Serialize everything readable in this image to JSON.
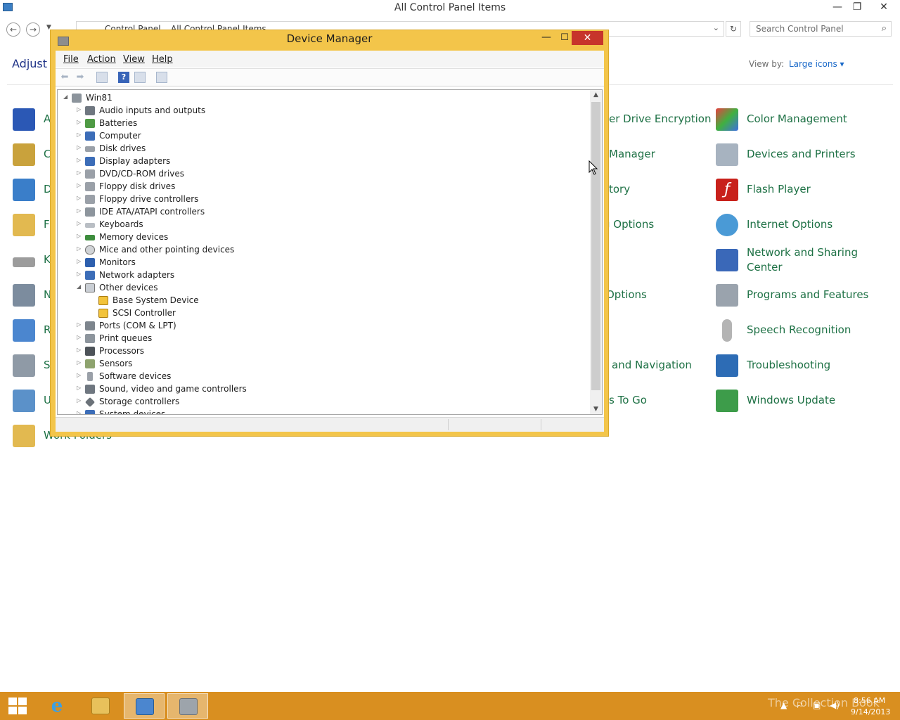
{
  "control_panel": {
    "window_title": "All Control Panel Items",
    "breadcrumb": [
      "Control Panel",
      "All Control Panel Items"
    ],
    "search_placeholder": "Search Control Panel",
    "heading_partial": "Adjust y",
    "view_by_label": "View by:",
    "view_by_value": "Large icons",
    "left_items": [
      {
        "label": "A",
        "icon": "action-center-flag-icon"
      },
      {
        "label": "C",
        "icon": "credential-icon"
      },
      {
        "label": "D",
        "icon": "display-icon"
      },
      {
        "label": "F",
        "icon": "folder-options-icon"
      },
      {
        "label": "K",
        "icon": "keyboard-icon"
      },
      {
        "label": "N",
        "icon": "network-icon"
      },
      {
        "label": "R",
        "icon": "remote-icon"
      },
      {
        "label": "S",
        "icon": "storage-icon"
      },
      {
        "label": "U",
        "icon": "user-accounts-icon"
      },
      {
        "label": "Work Folders",
        "icon": "work-folders-icon"
      }
    ],
    "middle_partial_items": [
      "er Drive Encryption",
      "Manager",
      "tory",
      "g Options",
      "Options",
      "and Navigation",
      "s To Go"
    ],
    "right_items": [
      {
        "label": "Color Management",
        "icon": "color-management-icon"
      },
      {
        "label": "Devices and Printers",
        "icon": "devices-printers-icon"
      },
      {
        "label": "Flash Player",
        "icon": "flash-player-icon"
      },
      {
        "label": "Internet Options",
        "icon": "internet-options-icon"
      },
      {
        "label": "Network and Sharing",
        "label2": "Center",
        "icon": "network-sharing-icon"
      },
      {
        "label": "Programs and Features",
        "icon": "programs-features-icon"
      },
      {
        "label": "Speech Recognition",
        "icon": "microphone-icon"
      },
      {
        "label": "Troubleshooting",
        "icon": "troubleshooting-icon"
      },
      {
        "label": "Windows Update",
        "icon": "windows-update-icon"
      }
    ]
  },
  "device_manager": {
    "title": "Device Manager",
    "menu": {
      "file": "File",
      "action": "Action",
      "view": "View",
      "help": "Help"
    },
    "root": "Win81",
    "nodes": [
      "Audio inputs and outputs",
      "Batteries",
      "Computer",
      "Disk drives",
      "Display adapters",
      "DVD/CD-ROM drives",
      "Floppy disk drives",
      "Floppy drive controllers",
      "IDE ATA/ATAPI controllers",
      "Keyboards",
      "Memory devices",
      "Mice and other pointing devices",
      "Monitors",
      "Network adapters",
      "Other devices",
      "Base System Device",
      "SCSI Controller",
      "Ports (COM & LPT)",
      "Print queues",
      "Processors",
      "Sensors",
      "Software devices",
      "Sound, video and game controllers",
      "Storage controllers",
      "System devices"
    ]
  },
  "taskbar": {
    "time": "8:56 AM",
    "date": "9/14/2013",
    "watermark": "The Collection Book"
  },
  "colors": {
    "window_frame": "#f3c54a",
    "taskbar": "#d98f20",
    "close": "#c7352b",
    "link_green": "#1e7145"
  }
}
